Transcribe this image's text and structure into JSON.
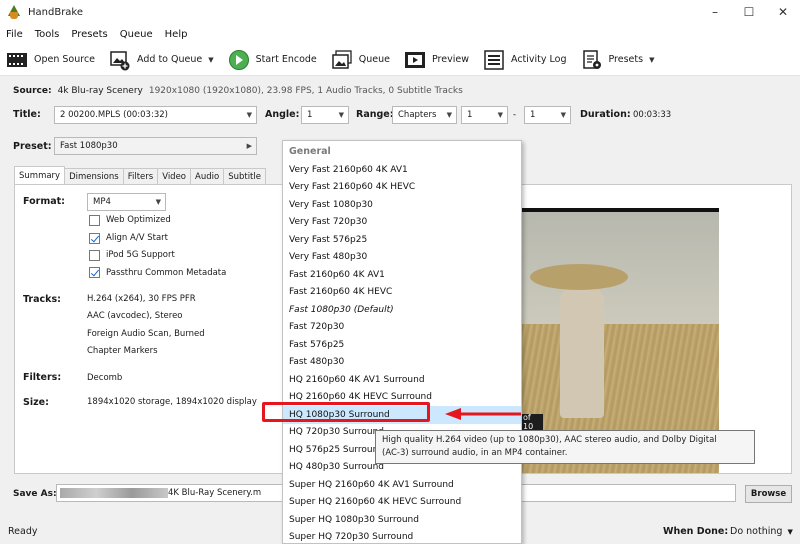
{
  "window": {
    "title": "HandBrake"
  },
  "menu": [
    "File",
    "Tools",
    "Presets",
    "Queue",
    "Help"
  ],
  "toolbar": {
    "open_source": "Open Source",
    "add_to_queue": "Add to Queue",
    "start_encode": "Start Encode",
    "queue": "Queue",
    "preview": "Preview",
    "activity_log": "Activity Log",
    "presets": "Presets"
  },
  "source": {
    "label": "Source:",
    "name": "4k Blu-ray Scenery",
    "info": "1920x1080 (1920x1080), 23.98 FPS, 1 Audio Tracks, 0 Subtitle Tracks"
  },
  "title_row": {
    "title_label": "Title:",
    "title_value": "2  00200.MPLS (00:03:32)",
    "angle_label": "Angle:",
    "angle_value": "1",
    "range_label": "Range:",
    "range_mode": "Chapters",
    "range_start": "1",
    "range_sep": "-",
    "range_end": "1",
    "duration_label": "Duration:",
    "duration_value": "00:03:33"
  },
  "preset": {
    "label": "Preset:",
    "value": "Fast 1080p30"
  },
  "tabs": [
    "Summary",
    "Dimensions",
    "Filters",
    "Video",
    "Audio",
    "Subtitle"
  ],
  "summary": {
    "format_label": "Format:",
    "format_value": "MP4",
    "options": [
      {
        "label": "Web Optimized",
        "checked": false
      },
      {
        "label": "Align A/V Start",
        "checked": true
      },
      {
        "label": "iPod 5G Support",
        "checked": false
      },
      {
        "label": "Passthru Common Metadata",
        "checked": true
      }
    ],
    "tracks_label": "Tracks:",
    "tracks": [
      "H.264 (x264), 30 FPS PFR",
      "AAC (avcodec), Stereo",
      "Foreign Audio Scan, Burned",
      "Chapter Markers"
    ],
    "filters_label": "Filters:",
    "filters_value": "Decomb",
    "size_label": "Size:",
    "size_value": "1894x1020 storage, 1894x1020 display"
  },
  "preview": {
    "page_indicator": "of 10"
  },
  "save_as": {
    "label": "Save As:",
    "filename": "4K Blu-Ray Scenery.m",
    "browse": "Browse"
  },
  "status": {
    "text": "Ready",
    "when_done_label": "When Done:",
    "when_done_value": "Do nothing"
  },
  "preset_menu": {
    "group": "General",
    "items": [
      "Very Fast 2160p60 4K AV1",
      "Very Fast 2160p60 4K HEVC",
      "Very Fast 1080p30",
      "Very Fast 720p30",
      "Very Fast 576p25",
      "Very Fast 480p30",
      "Fast 2160p60 4K AV1",
      "Fast 2160p60 4K HEVC",
      "Fast 1080p30 (Default)",
      "Fast 720p30",
      "Fast 576p25",
      "Fast 480p30",
      "HQ 2160p60 4K AV1 Surround",
      "HQ 2160p60 4K HEVC Surround",
      "HQ 1080p30 Surround",
      "HQ 720p30 Surround",
      "HQ 576p25 Surround",
      "HQ 480p30 Surround",
      "Super HQ 2160p60 4K AV1 Surround",
      "Super HQ 2160p60 4K HEVC Surround",
      "Super HQ 1080p30 Surround",
      "Super HQ 720p30 Surround"
    ],
    "tooltip_line1": "High quality H.264 video (up to 1080p30), AAC stereo audio, and Dolby Digital",
    "tooltip_line2": "(AC-3) surround audio, in an MP4 container."
  },
  "colors": {
    "highlight": "#cce8ff",
    "annotation_red": "#e5161e",
    "start_green": "#4caf50"
  }
}
